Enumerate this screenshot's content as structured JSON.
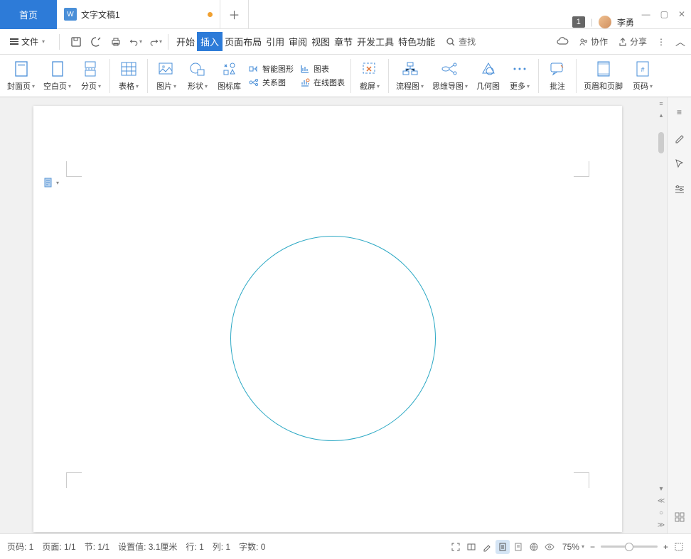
{
  "titlebar": {
    "home_tab": "首页",
    "doc_name": "文字文稿1",
    "badge": "1",
    "user": "李勇"
  },
  "menubar": {
    "file": "文件",
    "tabs": [
      "开始",
      "插入",
      "页面布局",
      "引用",
      "审阅",
      "视图",
      "章节",
      "开发工具",
      "特色功能"
    ],
    "active_tab_index": 1,
    "search": "查找",
    "cloud": "",
    "collab": "协作",
    "share": "分享"
  },
  "ribbon": {
    "cover": "封面页",
    "blank": "空白页",
    "page_break": "分页",
    "table": "表格",
    "picture": "图片",
    "shape": "形状",
    "icon_lib": "图标库",
    "smart_shape": "智能图形",
    "chart": "图表",
    "relation": "关系图",
    "online_chart": "在线图表",
    "screenshot": "截屏",
    "flowchart": "流程图",
    "mindmap": "思维导图",
    "geometry": "几何图",
    "more": "更多",
    "comment": "批注",
    "header_footer": "页眉和页脚",
    "page_num": "页码"
  },
  "status": {
    "page_no": "页码: 1",
    "page": "页面: 1/1",
    "section": "节: 1/1",
    "set_value": "设置值: 3.1厘米",
    "row": "行: 1",
    "col": "列: 1",
    "word_count": "字数: 0",
    "zoom": "75%"
  }
}
